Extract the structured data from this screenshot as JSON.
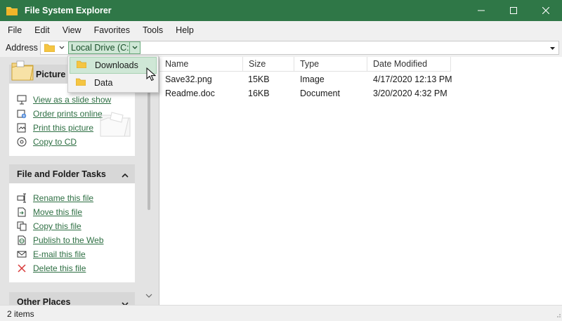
{
  "window": {
    "title": "File System Explorer"
  },
  "menu": {
    "items": [
      "File",
      "Edit",
      "View",
      "Favorites",
      "Tools",
      "Help"
    ]
  },
  "address": {
    "label": "Address",
    "current": "Local Drive (C:)"
  },
  "dropdown": {
    "items": [
      "Downloads",
      "Data"
    ],
    "highlighted": "Downloads"
  },
  "sidebar": {
    "picture_tasks": {
      "title": "Picture T",
      "items": [
        "View as a slide show",
        "Order prints online",
        "Print this picture",
        "Copy to CD"
      ]
    },
    "file_tasks": {
      "title": "File and Folder Tasks",
      "items": [
        "Rename this file",
        "Move this file",
        "Copy this file",
        "Publish to the Web",
        "E-mail this file",
        "Delete this file"
      ]
    },
    "other_places": {
      "title": "Other Places"
    }
  },
  "list": {
    "columns": [
      "Name",
      "Size",
      "Type",
      "Date Modified"
    ],
    "rows": [
      {
        "name": "Save32.png",
        "size": "15KB",
        "type": "Image",
        "modified": "4/17/2020 12:13 PM"
      },
      {
        "name": "Readme.doc",
        "size": "16KB",
        "type": "Document",
        "modified": "3/20/2020 4:32 PM"
      }
    ]
  },
  "status": {
    "text": "2 items"
  },
  "colors": {
    "titlebar": "#2f7747",
    "link": "#2e6f43",
    "highlight": "#cfe7d6",
    "folder": "#f0c040"
  },
  "icons": [
    "folder-icon",
    "minimize-icon",
    "maximize-icon",
    "close-icon",
    "chevron-down-icon",
    "slideshow-icon",
    "order-prints-icon",
    "print-icon",
    "cd-icon",
    "rename-icon",
    "move-icon",
    "copy-icon",
    "publish-icon",
    "email-icon",
    "delete-icon",
    "chevron-up-icon",
    "mouse-cursor-icon"
  ]
}
